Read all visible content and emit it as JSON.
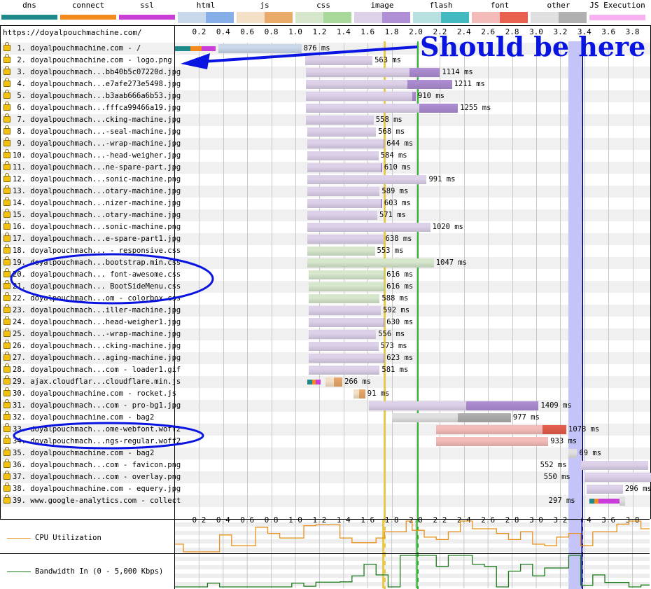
{
  "legend": [
    {
      "label": "dns",
      "colors": [
        "#1e8a8a",
        "#1e8a8a"
      ]
    },
    {
      "label": "connect",
      "colors": [
        "#f28a1e",
        "#f28a1e"
      ]
    },
    {
      "label": "ssl",
      "colors": [
        "#c93ed6",
        "#c93ed6"
      ]
    },
    {
      "label": "html",
      "colors": [
        "#c9d8ea",
        "#86aee8"
      ]
    },
    {
      "label": "js",
      "colors": [
        "#f3e0c6",
        "#eaaa6c"
      ]
    },
    {
      "label": "css",
      "colors": [
        "#d6e7cc",
        "#a9d99a"
      ]
    },
    {
      "label": "image",
      "colors": [
        "#ddd1ea",
        "#b08fd6"
      ]
    },
    {
      "label": "flash",
      "colors": [
        "#b8e0e0",
        "#45b9c0"
      ]
    },
    {
      "label": "font",
      "colors": [
        "#f3bcb8",
        "#e8604f"
      ]
    },
    {
      "label": "other",
      "colors": [
        "#e0e0e0",
        "#b0b0b0"
      ]
    },
    {
      "label": "JS Execution",
      "colors": [
        "#f8b2f2",
        "#f8b2f2"
      ]
    }
  ],
  "page_url": "https://doyalpouchmachine.com/",
  "axis_ticks": [
    "0.2",
    "0.4",
    "0.6",
    "0.8",
    "1.0",
    "1.2",
    "1.4",
    "1.6",
    "1.8",
    "2.0",
    "2.2",
    "2.4",
    "2.6",
    "2.8",
    "3.0",
    "3.2",
    "3.4",
    "3.6",
    "3.8"
  ],
  "markers": {
    "start_render_s": 1.73,
    "dom_content_loaded_s": 2.01,
    "on_load_start_s": 3.27,
    "on_load_end_s": 3.37,
    "doc_complete_s": 3.38
  },
  "requests": [
    {
      "n": "1.",
      "label": "doyalpouchmachine.com - /",
      "type": "html",
      "start": 0.0,
      "dns": 0.13,
      "connect": 0.09,
      "ssl": 0.12,
      "ttfb_start": 0.36,
      "content_start": 1.05,
      "end": 1.03,
      "ms": "876 ms",
      "label_side": "right"
    },
    {
      "n": "2.",
      "label": "doyalpouchmachine.com - logo.png",
      "type": "image",
      "start": 1.08,
      "content_start": 1.64,
      "end": 1.64,
      "ms": "563 ms"
    },
    {
      "n": "3.",
      "label": "doyalpouchmach...bb40b5c07220d.jpg",
      "type": "image",
      "start": 1.09,
      "content_start": 1.95,
      "end": 2.2,
      "ms": "1114 ms"
    },
    {
      "n": "4.",
      "label": "doyalpouchmach...e7afe273e5498.jpg",
      "type": "image",
      "start": 1.09,
      "content_start": 1.93,
      "end": 2.3,
      "ms": "1211 ms"
    },
    {
      "n": "5.",
      "label": "doyalpouchmach...b3aab666a6b53.jpg",
      "type": "image",
      "start": 1.09,
      "content_start": 1.97,
      "end": 2.0,
      "ms": "910 ms"
    },
    {
      "n": "6.",
      "label": "doyalpouchmach...fffca99466a19.jpg",
      "type": "image",
      "start": 1.09,
      "content_start": 2.03,
      "end": 2.35,
      "ms": "1255 ms"
    },
    {
      "n": "7.",
      "label": "doyalpouchmach...cking-machine.jpg",
      "type": "image",
      "start": 1.09,
      "content_start": 1.65,
      "end": 1.65,
      "ms": "558 ms"
    },
    {
      "n": "8.",
      "label": "doyalpouchmach...-seal-machine.jpg",
      "type": "image",
      "start": 1.1,
      "content_start": 1.67,
      "end": 1.67,
      "ms": "568 ms"
    },
    {
      "n": "9.",
      "label": "doyalpouchmach...-wrap-machine.jpg",
      "type": "image",
      "start": 1.1,
      "content_start": 1.73,
      "end": 1.74,
      "ms": "644 ms"
    },
    {
      "n": "10.",
      "label": "doyalpouchmach...-head-weigher.jpg",
      "type": "image",
      "start": 1.1,
      "content_start": 1.69,
      "end": 1.69,
      "ms": "584 ms"
    },
    {
      "n": "11.",
      "label": "doyalpouchmach...ne-spare-part.jpg",
      "type": "image",
      "start": 1.1,
      "content_start": 1.71,
      "end": 1.72,
      "ms": "610 ms"
    },
    {
      "n": "12.",
      "label": "doyalpouchmach...sonic-machine.png",
      "type": "image",
      "start": 1.1,
      "content_start": 2.09,
      "end": 2.09,
      "ms": "991 ms"
    },
    {
      "n": "13.",
      "label": "doyalpouchmach...otary-machine.jpg",
      "type": "image",
      "start": 1.1,
      "content_start": 1.7,
      "end": 1.7,
      "ms": "589 ms"
    },
    {
      "n": "14.",
      "label": "doyalpouchmach...nizer-machine.jpg",
      "type": "image",
      "start": 1.1,
      "content_start": 1.71,
      "end": 1.72,
      "ms": "603 ms"
    },
    {
      "n": "15.",
      "label": "doyalpouchmach...otary-machine.jpg",
      "type": "image",
      "start": 1.1,
      "content_start": 1.68,
      "end": 1.68,
      "ms": "571 ms"
    },
    {
      "n": "16.",
      "label": "doyalpouchmach...sonic-machine.png",
      "type": "image",
      "start": 1.1,
      "content_start": 2.12,
      "end": 2.12,
      "ms": "1020 ms"
    },
    {
      "n": "17.",
      "label": "doyalpouchmach...e-spare-part1.jpg",
      "type": "image",
      "start": 1.1,
      "content_start": 1.73,
      "end": 1.73,
      "ms": "638 ms"
    },
    {
      "n": "18.",
      "label": "doyalpouchmach... - responsive.css",
      "type": "css",
      "start": 1.1,
      "content_start": 1.66,
      "end": 1.66,
      "ms": "553 ms"
    },
    {
      "n": "19.",
      "label": "doyalpouchmach...bootstrap.min.css",
      "type": "css",
      "start": 1.1,
      "content_start": 2.15,
      "end": 2.15,
      "ms": "1047 ms"
    },
    {
      "n": "20.",
      "label": "doyalpouchmach... font-awesome.css",
      "type": "css",
      "start": 1.11,
      "content_start": 1.73,
      "end": 1.74,
      "ms": "616 ms"
    },
    {
      "n": "21.",
      "label": "doyalpouchmach... BootSideMenu.css",
      "type": "css",
      "start": 1.11,
      "content_start": 1.73,
      "end": 1.74,
      "ms": "616 ms"
    },
    {
      "n": "22.",
      "label": "doyalpouchmach...om - colorbox.css",
      "type": "css",
      "start": 1.11,
      "content_start": 1.7,
      "end": 1.7,
      "ms": "588 ms"
    },
    {
      "n": "23.",
      "label": "doyalpouchmach...iller-machine.jpg",
      "type": "image",
      "start": 1.11,
      "content_start": 1.71,
      "end": 1.71,
      "ms": "592 ms"
    },
    {
      "n": "24.",
      "label": "doyalpouchmach...head-weigher1.jpg",
      "type": "image",
      "start": 1.11,
      "content_start": 1.73,
      "end": 1.74,
      "ms": "630 ms"
    },
    {
      "n": "25.",
      "label": "doyalpouchmach...-wrap-machine.jpg",
      "type": "image",
      "start": 1.11,
      "content_start": 1.67,
      "end": 1.67,
      "ms": "556 ms"
    },
    {
      "n": "26.",
      "label": "doyalpouchmach...cking-machine.jpg",
      "type": "image",
      "start": 1.11,
      "content_start": 1.69,
      "end": 1.69,
      "ms": "573 ms"
    },
    {
      "n": "27.",
      "label": "doyalpouchmach...aging-machine.jpg",
      "type": "image",
      "start": 1.11,
      "content_start": 1.73,
      "end": 1.74,
      "ms": "623 ms"
    },
    {
      "n": "28.",
      "label": "doyalpouchmach...com - loader1.gif",
      "type": "image",
      "start": 1.11,
      "content_start": 1.7,
      "end": 1.7,
      "ms": "581 ms"
    },
    {
      "n": "29.",
      "label": "ajax.cloudflar...cloudflare.min.js",
      "type": "js",
      "start": 1.1,
      "dns": 0.04,
      "connect": 0.03,
      "ssl": 0.04,
      "ttfb_start": 1.25,
      "content_start": 1.32,
      "end": 1.39,
      "ms": "266 ms"
    },
    {
      "n": "30.",
      "label": "doyalpouchmachine.com - rocket.js",
      "type": "js",
      "start": 1.48,
      "content_start": 1.53,
      "end": 1.58,
      "ms": "91 ms"
    },
    {
      "n": "31.",
      "label": "doyalpouchmach...com - pro-bg1.jpg",
      "type": "image",
      "start": 1.61,
      "content_start": 2.42,
      "end": 3.02,
      "ms": "1409 ms"
    },
    {
      "n": "32.",
      "label": "doyalpouchmachine.com - bag2",
      "type": "other",
      "start": 1.8,
      "content_start": 2.35,
      "end": 2.79,
      "ms": "977 ms"
    },
    {
      "n": "33.",
      "label": "doyalpouchmach...ome-webfont.woff2",
      "type": "font",
      "start": 2.17,
      "content_start": 3.05,
      "end": 3.25,
      "ms": "1078 ms"
    },
    {
      "n": "34.",
      "label": "doyalpouchmach...ngs-regular.woff2",
      "type": "font",
      "start": 2.17,
      "content_start": 3.1,
      "end": 3.1,
      "ms": "933 ms"
    },
    {
      "n": "35.",
      "label": "doyalpouchmachine.com - bag2",
      "type": "other",
      "start": 3.27,
      "content_start": 3.34,
      "end": 3.34,
      "ms": "69 ms"
    },
    {
      "n": "36.",
      "label": "doyalpouchmach...com - favicon.png",
      "type": "image",
      "start": 3.37,
      "content_start": 3.93,
      "end": 3.93,
      "ms": "552 ms",
      "label_side": "left"
    },
    {
      "n": "37.",
      "label": "doyalpouchmach...com - overlay.png",
      "type": "image",
      "start": 3.4,
      "content_start": 3.96,
      "end": 3.96,
      "ms": "550 ms",
      "label_side": "left"
    },
    {
      "n": "38.",
      "label": "doyalpouchmachine.com - equery.jpg",
      "type": "image",
      "start": 3.42,
      "content_start": 3.72,
      "end": 3.72,
      "ms": "296 ms"
    },
    {
      "n": "39.",
      "label": "www.google-analytics.com - collect",
      "type": "other",
      "start": 3.44,
      "dns": 0.04,
      "connect": 0.04,
      "ssl": 0.17,
      "ttfb_start": 3.69,
      "content_start": 3.74,
      "end": 3.74,
      "ms": "297 ms",
      "label_side": "left"
    }
  ],
  "cpu": {
    "label": "CPU Utilization",
    "color": "#e8901a",
    "times": [
      0.0,
      0.07,
      0.27,
      0.37,
      0.47,
      0.67,
      0.77,
      0.87,
      1.07,
      1.17,
      1.37,
      1.47,
      1.67,
      1.74,
      1.92,
      1.97,
      2.07,
      2.17,
      2.27,
      2.37,
      2.47,
      2.67,
      2.77,
      2.87,
      2.97,
      3.07,
      3.17,
      3.27,
      3.37,
      3.47,
      3.67,
      3.77,
      3.87,
      3.97
    ],
    "values": [
      0.25,
      0.0,
      0.0,
      0.55,
      0.2,
      0.8,
      0.6,
      0.45,
      0.85,
      0.88,
      0.45,
      0.3,
      0.45,
      0.65,
      1.0,
      0.7,
      0.48,
      0.4,
      0.65,
      1.0,
      0.75,
      0.6,
      0.4,
      0.65,
      0.25,
      0.2,
      0.48,
      0.6,
      0.2,
      0.65,
      0.9,
      1.0,
      0.75,
      0.35,
      0.4
    ]
  },
  "bandwidth": {
    "label": "Bandwidth In (0 - 5,000 Kbps)",
    "color": "#1a7a1a",
    "times": [
      0.0,
      0.27,
      0.37,
      0.97,
      1.07,
      1.17,
      1.37,
      1.47,
      1.57,
      1.67,
      1.77,
      1.87,
      2.07,
      2.17,
      2.27,
      2.47,
      2.57,
      2.67,
      2.77,
      2.87,
      2.97,
      3.07,
      3.27,
      3.37,
      3.47,
      3.57,
      3.77,
      3.87
    ],
    "values": [
      0.0,
      0.12,
      0.0,
      0.12,
      0.02,
      0.15,
      0.16,
      0.35,
      0.72,
      0.38,
      0.0,
      1.0,
      1.0,
      0.65,
      1.0,
      0.72,
      0.65,
      0.0,
      0.5,
      0.72,
      0.35,
      0.6,
      1.0,
      0.05,
      0.38,
      0.14,
      0.0,
      0.06,
      0.04,
      0.0,
      0.03
    ]
  },
  "annotation": {
    "text": "Should be here",
    "color": "#0a14e0"
  }
}
